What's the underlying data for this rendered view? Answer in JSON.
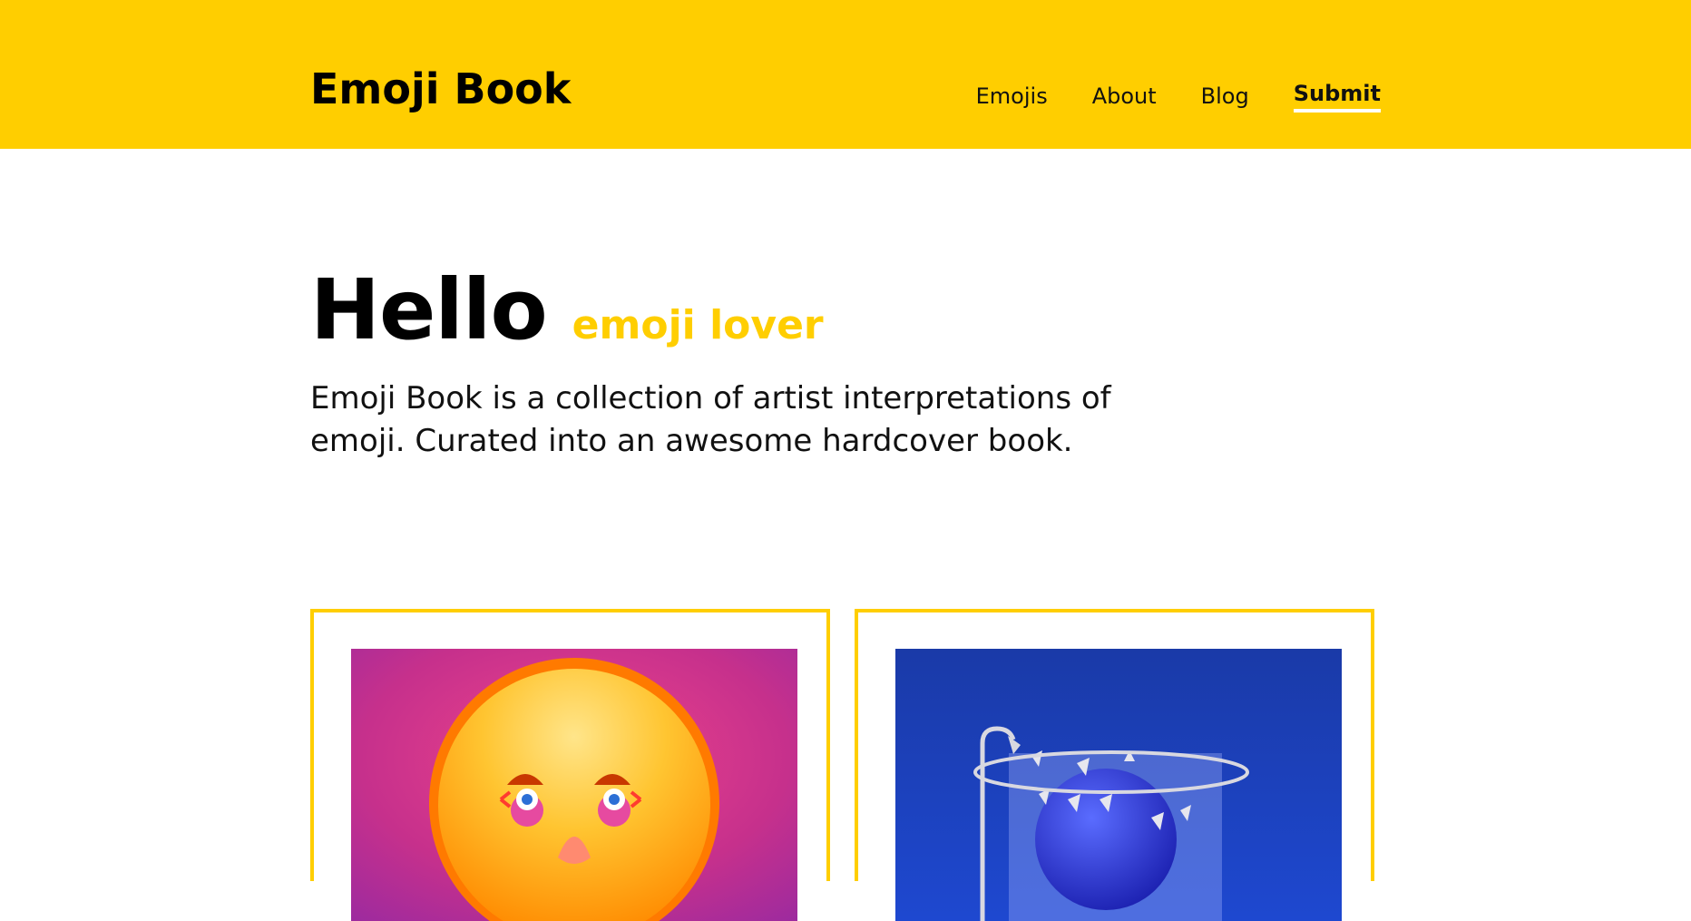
{
  "header": {
    "logo": "Emoji Book",
    "nav": [
      {
        "label": "Emojis"
      },
      {
        "label": "About"
      },
      {
        "label": "Blog"
      },
      {
        "label": "Submit"
      }
    ],
    "background": "#ffce00"
  },
  "hero": {
    "hello": "Hello",
    "subtitle": "emoji lover",
    "intro": "Emoji Book is a collection of artist interpretations of emoji. Curated into an awesome hardcover book."
  },
  "colors": {
    "accent": "#ffce00",
    "text": "#111111"
  },
  "cards": [
    {
      "image": "smiling-face-with-clown-eyes-artwork",
      "background": "#c6308c"
    },
    {
      "image": "spiky-ball-in-shower-artwork",
      "background": "#1a3ec0"
    }
  ]
}
